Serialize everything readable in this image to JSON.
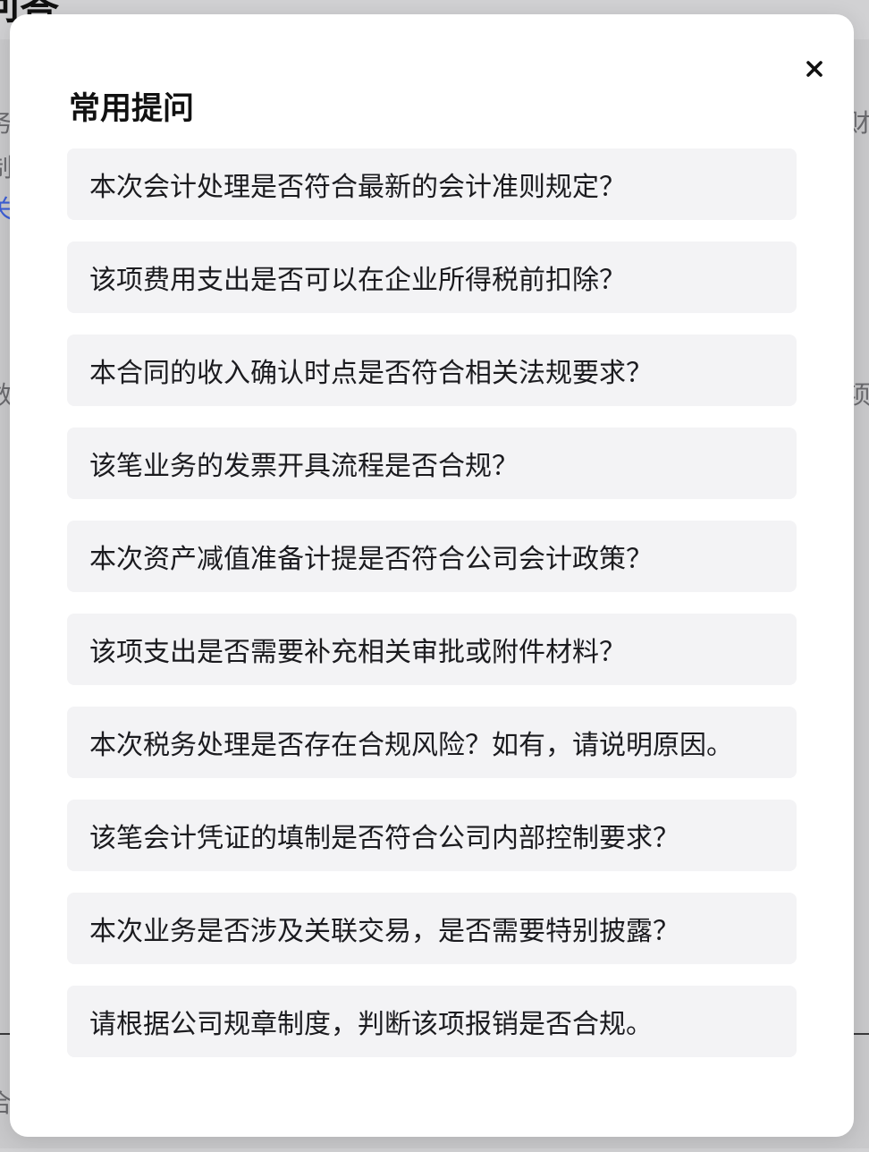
{
  "background": {
    "page_title": "问答",
    "fragments_left": [
      "务",
      "制",
      "关",
      "数",
      "合"
    ],
    "fragments_right": [
      "财务",
      "项i"
    ]
  },
  "modal": {
    "title": "常用提问",
    "close_icon": "close-icon",
    "questions": [
      "本次会计处理是否符合最新的会计准则规定？",
      "该项费用支出是否可以在企业所得税前扣除？",
      "本合同的收入确认时点是否符合相关法规要求？",
      "该笔业务的发票开具流程是否合规？",
      "本次资产减值准备计提是否符合公司会计政策？",
      "该项支出是否需要补充相关审批或附件材料？",
      "本次税务处理是否存在合规风险？如有，请说明原因。",
      "该笔会计凭证的填制是否符合公司内部控制要求？",
      "本次业务是否涉及关联交易，是否需要特别披露？",
      "请根据公司规章制度，判断该项报销是否合规。"
    ]
  },
  "colors": {
    "overlay": "#d1d1d3",
    "modal_bg": "#ffffff",
    "item_bg": "#f3f3f5",
    "text": "#1b1b1f",
    "link": "#3d5fd6"
  }
}
